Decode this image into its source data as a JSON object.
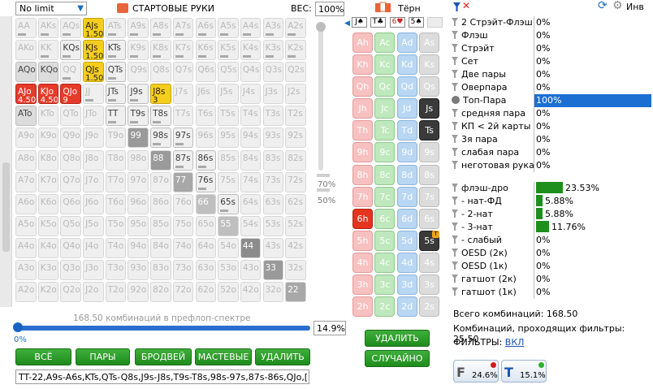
{
  "toolbar": {
    "limit": "No limit",
    "hands_title": "СТАРТОВЫЕ РУКИ",
    "weight_label": "ВЕС:",
    "weight_value": "100%"
  },
  "grid": [
    [
      "AA",
      "AKs",
      "AQs",
      "AJs",
      "ATs",
      "A9s",
      "A8s",
      "A7s",
      "A6s",
      "A5s",
      "A4s",
      "A3s",
      "A2s"
    ],
    [
      "AKo",
      "KK",
      "KQs",
      "KJs",
      "KTs",
      "K9s",
      "K8s",
      "K7s",
      "K6s",
      "K5s",
      "K4s",
      "K3s",
      "K2s"
    ],
    [
      "AQo",
      "KQo",
      "QQ",
      "QJs",
      "QTs",
      "Q9s",
      "Q8s",
      "Q7s",
      "Q6s",
      "Q5s",
      "Q4s",
      "Q3s",
      "Q2s"
    ],
    [
      "AJo",
      "KJo",
      "QJo",
      "JJ",
      "JTs",
      "J9s",
      "J8s",
      "J7s",
      "J6s",
      "J5s",
      "J4s",
      "J3s",
      "J2s"
    ],
    [
      "ATo",
      "KTo",
      "QTo",
      "JTo",
      "TT",
      "T9s",
      "T8s",
      "T7s",
      "T6s",
      "T5s",
      "T4s",
      "T3s",
      "T2s"
    ],
    [
      "A9o",
      "K9o",
      "Q9o",
      "J9o",
      "T9o",
      "99",
      "98s",
      "97s",
      "96s",
      "95s",
      "94s",
      "93s",
      "92s"
    ],
    [
      "A8o",
      "K8o",
      "Q8o",
      "J8o",
      "T8o",
      "98o",
      "88",
      "87s",
      "86s",
      "85s",
      "84s",
      "83s",
      "82s"
    ],
    [
      "A7o",
      "K7o",
      "Q7o",
      "J7o",
      "T7o",
      "97o",
      "87o",
      "77",
      "76s",
      "75s",
      "74s",
      "73s",
      "72s"
    ],
    [
      "A6o",
      "K6o",
      "Q6o",
      "J6o",
      "T6o",
      "96o",
      "86o",
      "76o",
      "66",
      "65s",
      "64s",
      "63s",
      "62s"
    ],
    [
      "A5o",
      "K5o",
      "Q5o",
      "J5o",
      "T5o",
      "95o",
      "85o",
      "75o",
      "65o",
      "55",
      "54s",
      "53s",
      "52s"
    ],
    [
      "A4o",
      "K4o",
      "Q4o",
      "J4o",
      "T4o",
      "94o",
      "84o",
      "74o",
      "64o",
      "54o",
      "44",
      "43s",
      "42s"
    ],
    [
      "A3o",
      "K3o",
      "Q3o",
      "J3o",
      "T3o",
      "93o",
      "83o",
      "73o",
      "63o",
      "53o",
      "43o",
      "33",
      "32s"
    ],
    [
      "A2o",
      "K2o",
      "Q2o",
      "J2o",
      "T2o",
      "92o",
      "82o",
      "72o",
      "62o",
      "52o",
      "42o",
      "32o",
      "22"
    ]
  ],
  "grid_state": {
    "0,3": {
      "s": "yel",
      "w": "1.50"
    },
    "1,3": {
      "s": "yel",
      "w": "1.50"
    },
    "2,3": {
      "s": "yel",
      "w": "1.50"
    },
    "3,6": {
      "s": "yel",
      "w": "3"
    },
    "3,0": {
      "s": "red",
      "w": "4.50"
    },
    "3,1": {
      "s": "red",
      "w": "4.50"
    },
    "3,2": {
      "s": "red",
      "w": "9"
    },
    "5,5": {
      "s": "g3"
    },
    "6,6": {
      "s": "g3"
    },
    "7,7": {
      "s": "g2"
    },
    "8,8": {
      "s": "g1"
    },
    "9,9": {
      "s": "g1"
    },
    "10,10": {
      "s": "g4"
    },
    "11,11": {
      "s": "g3"
    },
    "12,12": {
      "s": "g2"
    },
    "2,0": {
      "s": "lg",
      "bar": 1
    },
    "2,1": {
      "s": "lg",
      "bar": 1
    },
    "4,0": {
      "s": "lg",
      "bar": 1
    }
  },
  "on_cells": [
    "1,2",
    "1,4",
    "2,4",
    "3,4",
    "3,5",
    "4,4",
    "4,5",
    "4,6",
    "5,6",
    "5,7",
    "6,7",
    "6,8",
    "7,8",
    "8,9",
    "2,0",
    "2,1",
    "4,0"
  ],
  "bar_cells": [
    "0,0",
    "0,1",
    "0,2",
    "0,3",
    "0,4",
    "0,5",
    "0,6",
    "0,7",
    "0,8",
    "0,9",
    "0,10",
    "0,11",
    "0,12",
    "1,1",
    "1,2",
    "1,3",
    "1,4",
    "1,5",
    "1,6",
    "1,7",
    "1,8",
    "1,9",
    "1,10",
    "1,11",
    "1,12",
    "2,2",
    "2,3",
    "2,4",
    "3,3",
    "3,4",
    "3,5",
    "4,4",
    "4,5",
    "4,6",
    "5,6",
    "5,7",
    "6,7",
    "6,8",
    "7,8",
    "8,9"
  ],
  "slider": {
    "pct_70": "70%",
    "pct_50": "50%"
  },
  "bottom": {
    "combo_text": "168.50 комбинаций в префлоп-спектре",
    "pct_zero": "0%",
    "pct_value": "14.9%",
    "buttons": [
      "ВСЁ",
      "ПАРЫ",
      "БРОДВЕЙ",
      "МАСТЕВЫЕ",
      "УДАЛИТЬ"
    ],
    "range": "TT-22,A9s-A6s,KTs,QTs-Q8s,J9s-J8s,T9s-T8s,98s-97s,87s-86s,QJo,["
  },
  "board": {
    "title": "Тёрн",
    "cards": [
      "J♠",
      "T♣",
      "6♥",
      "5♠"
    ],
    "delete_label": "УДАЛИТЬ",
    "random_label": "СЛУЧАЙНО"
  },
  "deck": [
    [
      "Ah",
      "Ac",
      "Ad",
      "As"
    ],
    [
      "Kh",
      "Kc",
      "Kd",
      "Ks"
    ],
    [
      "Qh",
      "Qc",
      "Qd",
      "Qs"
    ],
    [
      "Jh",
      "Jc",
      "Jd",
      "Js"
    ],
    [
      "Th",
      "Tc",
      "Td",
      "Ts"
    ],
    [
      "9h",
      "9c",
      "9d",
      "9s"
    ],
    [
      "8h",
      "8c",
      "8d",
      "8s"
    ],
    [
      "7h",
      "7c",
      "7d",
      "7s"
    ],
    [
      "6h",
      "6c",
      "6d",
      "6s"
    ],
    [
      "5h",
      "5c",
      "5d",
      "5s"
    ],
    [
      "4h",
      "4c",
      "4d",
      "4s"
    ],
    [
      "3h",
      "3c",
      "3d",
      "3s"
    ],
    [
      "2h",
      "2c",
      "2d",
      "2s"
    ]
  ],
  "stats": [
    {
      "label": "2 Стрэйт-Флэш",
      "value": "0%"
    },
    {
      "label": "Флэш",
      "value": "0%"
    },
    {
      "label": "Стрэйт",
      "value": "0%"
    },
    {
      "label": "Сет",
      "value": "0%"
    },
    {
      "label": "Две пары",
      "value": "0%"
    },
    {
      "label": "Оверпара",
      "value": "0%"
    },
    {
      "label": "Топ-Пара",
      "value": "100%",
      "sel": true
    },
    {
      "label": "средняя пара",
      "value": "0%"
    },
    {
      "label": "КП < 2й карты",
      "value": "0%"
    },
    {
      "label": "3я пара",
      "value": "0%"
    },
    {
      "label": "слабая пара",
      "value": "0%"
    },
    {
      "label": "неготовая рука",
      "value": "0%"
    },
    {
      "label": "флэш-дро",
      "value": "23.53%",
      "bar": 0.2353
    },
    {
      "label": "- нат-ФД",
      "value": "5.88%",
      "bar": 0.0588
    },
    {
      "label": "- 2-нат",
      "value": "5.88%",
      "bar": 0.0588
    },
    {
      "label": "- 3-нат",
      "value": "11.76%",
      "bar": 0.1176
    },
    {
      "label": "- слабый",
      "value": "0%"
    },
    {
      "label": "OESD (2к)",
      "value": "0%"
    },
    {
      "label": "OESD (1к)",
      "value": "0%"
    },
    {
      "label": "гатшот (2к)",
      "value": "0%"
    },
    {
      "label": "гатшот (1к)",
      "value": "0%"
    }
  ],
  "summary": {
    "total": "Всего комбинаций: 168.50",
    "passing": "Комбинаций, проходящих фильтры: 25.50",
    "filters_label": "ФИЛЬТРЫ:",
    "filters_value": "ВКЛ",
    "inv_label": "Инв",
    "f_pct": "24.6%",
    "t_pct": "15.1%"
  }
}
